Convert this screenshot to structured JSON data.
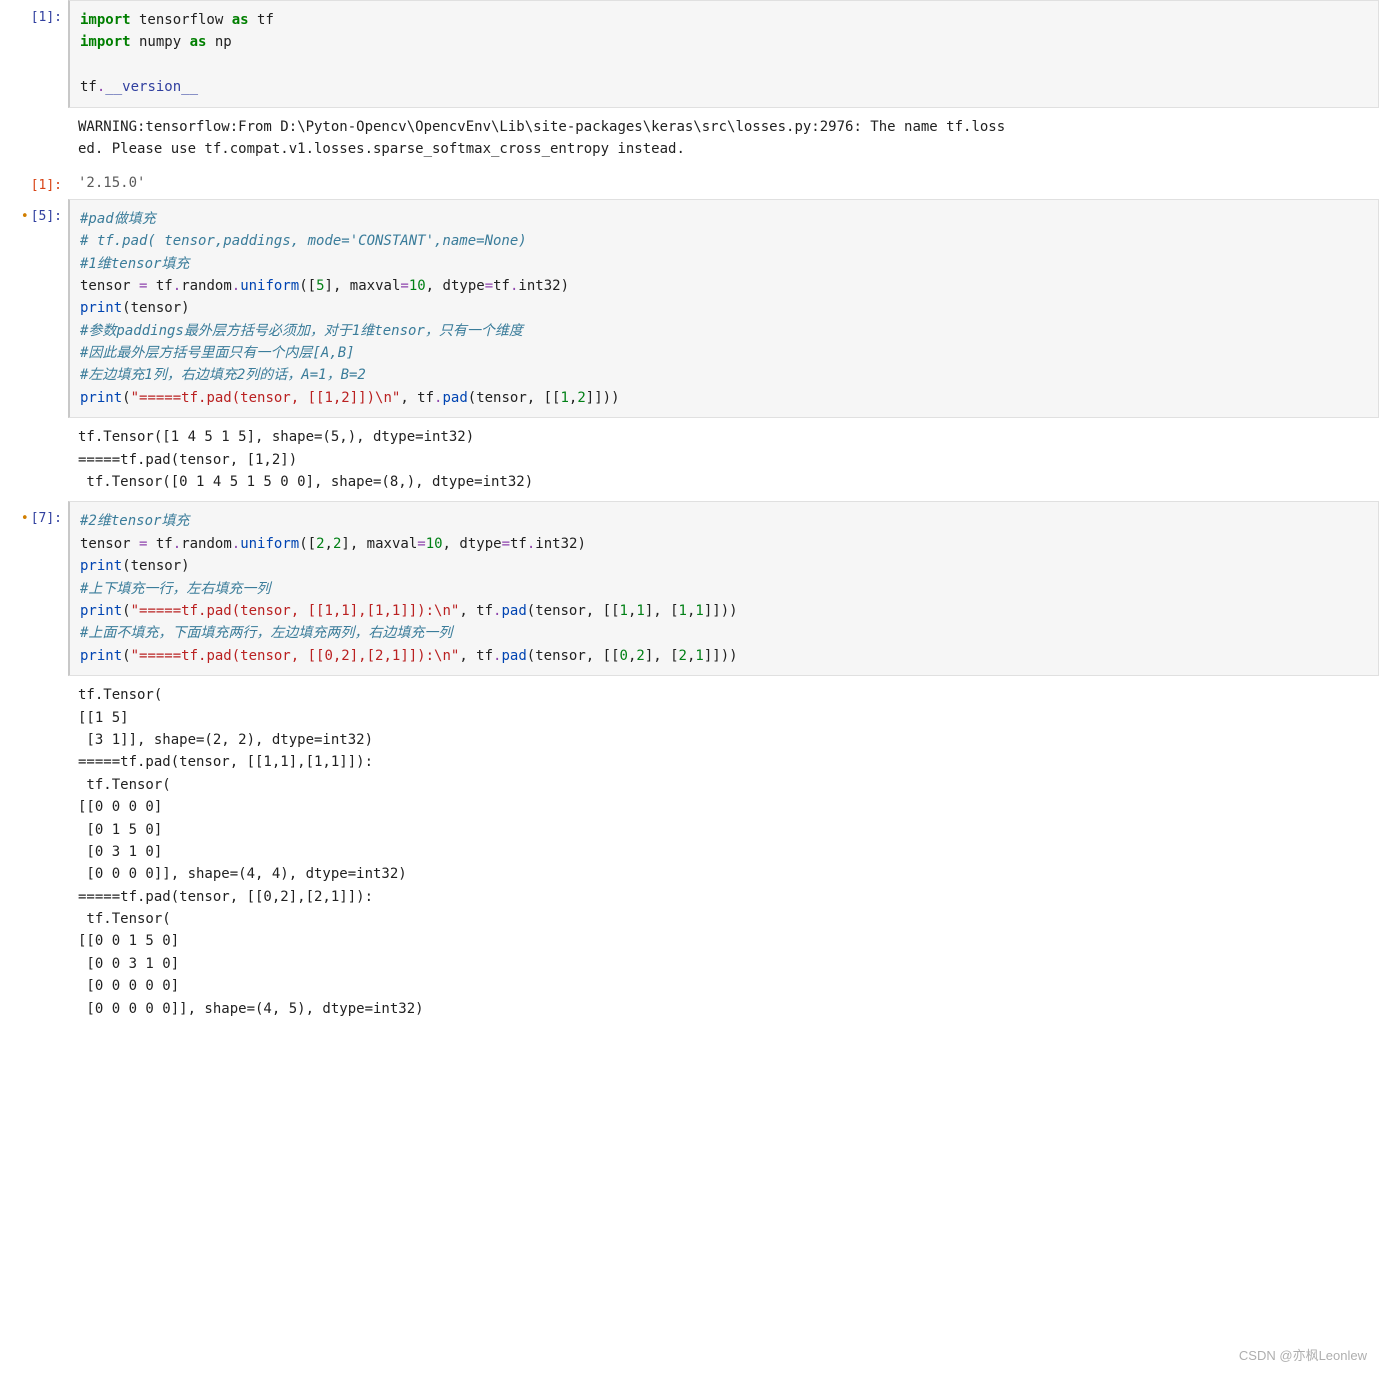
{
  "cells": [
    {
      "prompt": "[1]:",
      "modified": false,
      "type": "code",
      "input_html": "<span class='kw'>import</span> tensorflow <span class='kw'>as</span> tf\n<span class='kw'>import</span> numpy <span class='kw'>as</span> np\n\ntf<span class='op'>.</span><span class='spc'>__version__</span>",
      "outputs": [
        {
          "kind": "stream",
          "text": "WARNING:tensorflow:From D:\\Pyton-Opencv\\OpencvEnv\\Lib\\site-packages\\keras\\src\\losses.py:2976: The name tf.loss\ned. Please use tf.compat.v1.losses.sparse_softmax_cross_entropy instead."
        },
        {
          "kind": "result",
          "prompt": "[1]:",
          "text": "'2.15.0'"
        }
      ]
    },
    {
      "prompt": "[5]:",
      "modified": true,
      "type": "code",
      "input_html": "<span class='cmt'>#pad做填充</span>\n<span class='cmt'># tf.pad( tensor,paddings, mode='CONSTANT',name=None)</span>\n<span class='cmt'>#1维tensor填充</span>\ntensor <span class='op'>=</span> tf<span class='op'>.</span>random<span class='op'>.</span><span class='fn'>uniform</span>([<span class='num'>5</span>], maxval<span class='op'>=</span><span class='num'>10</span>, dtype<span class='op'>=</span>tf<span class='op'>.</span>int32)\n<span class='fn'>print</span>(tensor)\n<span class='cmt'>#参数paddings最外层方括号必须加，对于1维tensor，只有一个维度</span>\n<span class='cmt'>#因此最外层方括号里面只有一个内层[A,B]</span>\n<span class='cmt'>#左边填充1列，右边填充2列的话，A=1，B=2</span>\n<span class='fn'>print</span>(<span class='str'>\"=====tf.pad(tensor, [[1,2]])\\n\"</span>, tf<span class='op'>.</span><span class='fn'>pad</span>(tensor, [[<span class='num'>1</span>,<span class='num'>2</span>]]))",
      "outputs": [
        {
          "kind": "stream",
          "text": "tf.Tensor([1 4 5 1 5], shape=(5,), dtype=int32)\n=====tf.pad(tensor, [1,2])\n tf.Tensor([0 1 4 5 1 5 0 0], shape=(8,), dtype=int32)"
        }
      ]
    },
    {
      "prompt": "[7]:",
      "modified": true,
      "type": "code",
      "input_html": "<span class='cmt'>#2维tensor填充</span>\ntensor <span class='op'>=</span> tf<span class='op'>.</span>random<span class='op'>.</span><span class='fn'>uniform</span>([<span class='num'>2</span>,<span class='num'>2</span>], maxval<span class='op'>=</span><span class='num'>10</span>, dtype<span class='op'>=</span>tf<span class='op'>.</span>int32)\n<span class='fn'>print</span>(tensor)\n<span class='cmt'>#上下填充一行，左右填充一列</span>\n<span class='fn'>print</span>(<span class='str'>\"=====tf.pad(tensor, [[1,1],[1,1]]):\\n\"</span>, tf<span class='op'>.</span><span class='fn'>pad</span>(tensor, [[<span class='num'>1</span>,<span class='num'>1</span>], [<span class='num'>1</span>,<span class='num'>1</span>]]))\n<span class='cmt'>#上面不填充，下面填充两行，左边填充两列，右边填充一列</span>\n<span class='fn'>print</span>(<span class='str'>\"=====tf.pad(tensor, [[0,2],[2,1]]):\\n\"</span>, tf<span class='op'>.</span><span class='fn'>pad</span>(tensor, [[<span class='num'>0</span>,<span class='num'>2</span>], [<span class='num'>2</span>,<span class='num'>1</span>]]))",
      "outputs": [
        {
          "kind": "stream",
          "text": "tf.Tensor(\n[[1 5]\n [3 1]], shape=(2, 2), dtype=int32)\n=====tf.pad(tensor, [[1,1],[1,1]]):\n tf.Tensor(\n[[0 0 0 0]\n [0 1 5 0]\n [0 3 1 0]\n [0 0 0 0]], shape=(4, 4), dtype=int32)\n=====tf.pad(tensor, [[0,2],[2,1]]):\n tf.Tensor(\n[[0 0 1 5 0]\n [0 0 3 1 0]\n [0 0 0 0 0]\n [0 0 0 0 0]], shape=(4, 5), dtype=int32)"
        }
      ]
    }
  ],
  "watermark": "CSDN @亦枫Leonlew"
}
